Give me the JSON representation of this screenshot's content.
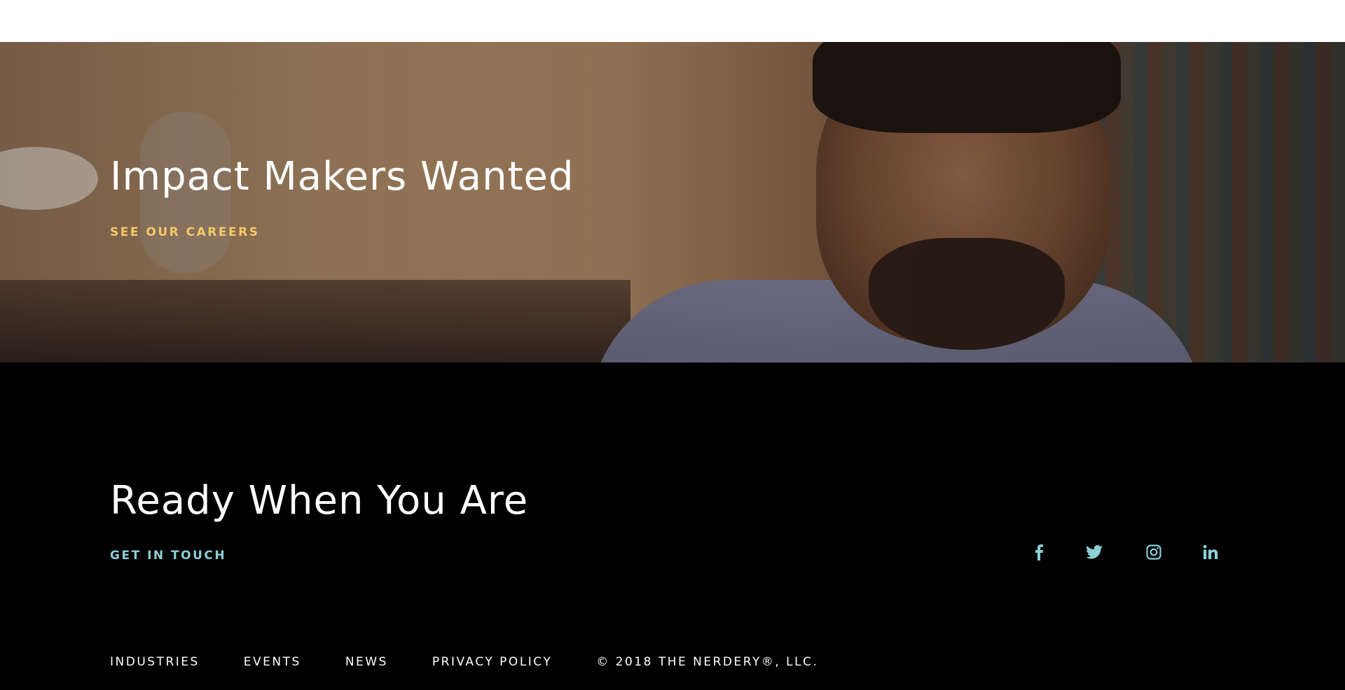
{
  "hero": {
    "title": "Impact Makers Wanted",
    "cta_label": "SEE OUR CAREERS",
    "cta_color": "#f5c96a"
  },
  "footer": {
    "title": "Ready When You Are",
    "cta_label": "GET IN TOUCH",
    "cta_color": "#8ccfd6",
    "social": [
      {
        "name": "facebook",
        "icon": "facebook-icon"
      },
      {
        "name": "twitter",
        "icon": "twitter-icon"
      },
      {
        "name": "instagram",
        "icon": "instagram-icon"
      },
      {
        "name": "linkedin",
        "icon": "linkedin-icon"
      }
    ],
    "nav": {
      "industries": "INDUSTRIES",
      "events": "EVENTS",
      "news": "NEWS",
      "privacy": "PRIVACY POLICY"
    },
    "copyright": "© 2018 THE NERDERY®, LLC."
  }
}
